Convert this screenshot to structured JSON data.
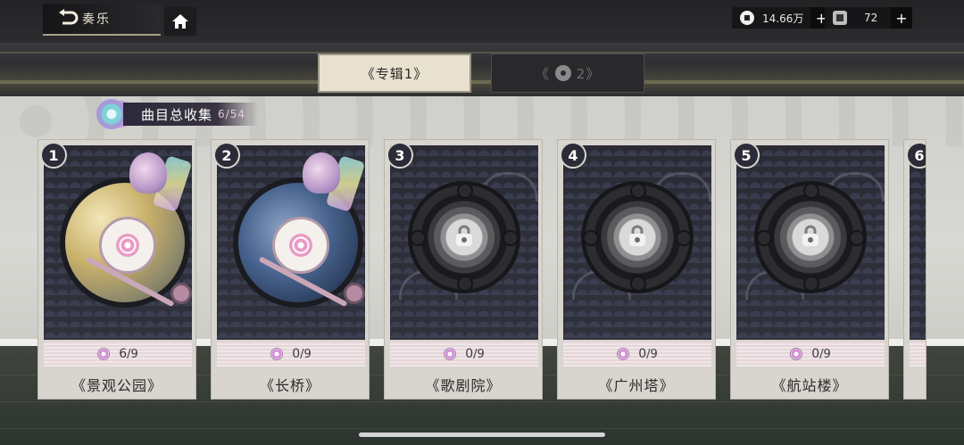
{
  "header": {
    "back_label": "奏乐",
    "currencies": [
      {
        "icon": "coin-icon",
        "amount": "14.66万"
      },
      {
        "icon": "ticket-icon",
        "amount": "72"
      }
    ],
    "plus_symbol": "+"
  },
  "album_tabs": [
    {
      "label": "《专辑1》",
      "active": true
    },
    {
      "label_left": "《",
      "label_right": "2》",
      "active": false,
      "locked": true
    }
  ],
  "collection": {
    "label": "曲目总收集",
    "count": "6/54"
  },
  "cards": [
    {
      "number": "1",
      "title": "《景观公园》",
      "progress_got": "6",
      "progress_total": "/9",
      "unlocked": true
    },
    {
      "number": "2",
      "title": "《长桥》",
      "progress_got": "0",
      "progress_total": "/9",
      "unlocked": true
    },
    {
      "number": "3",
      "title": "《歌剧院》",
      "progress_got": "0",
      "progress_total": "/9",
      "unlocked": false
    },
    {
      "number": "4",
      "title": "《广州塔》",
      "progress_got": "0",
      "progress_total": "/9",
      "unlocked": false
    },
    {
      "number": "5",
      "title": "《航站楼》",
      "progress_got": "0",
      "progress_total": "/9",
      "unlocked": false
    },
    {
      "number": "6",
      "unlocked": false
    }
  ],
  "colors": {
    "active_tab_bg": "#e9e1cf",
    "card_bg": "#d8d5cf",
    "accent_pink": "#d48bd8"
  }
}
